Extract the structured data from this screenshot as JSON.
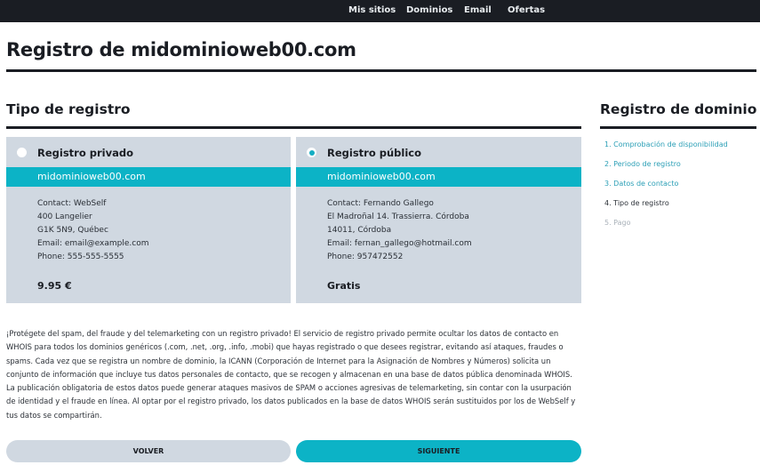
{
  "topnav": [
    "Mis sitios",
    "Dominios",
    "Email",
    "Ofertas"
  ],
  "page_title": "Registro de midominioweb00.com",
  "section_title": "Tipo de registro",
  "sidebar_title": "Registro de dominio",
  "options": [
    {
      "title": "Registro privado",
      "selected": false,
      "domain": "midominioweb00.com",
      "lines": [
        "Contact: WebSelf",
        "400 Langelier",
        "G1K 5N9, Québec",
        "Email: email@example.com",
        "Phone: 555-555-5555"
      ],
      "price": "9.95 €"
    },
    {
      "title": "Registro público",
      "selected": true,
      "domain": "midominioweb00.com",
      "lines": [
        "Contact: Fernando Gallego",
        "El Madroñal 14. Trassierra. Córdoba",
        "14011, Córdoba",
        "Email: fernan_gallego@hotmail.com",
        "Phone: 957472552"
      ],
      "price": "Gratis"
    }
  ],
  "steps": [
    {
      "label": "1. Comprobación de disponibilidad",
      "state": "done"
    },
    {
      "label": "2. Periodo de registro",
      "state": "done"
    },
    {
      "label": "3. Datos de contacto",
      "state": "done"
    },
    {
      "label": "4. Tipo de registro",
      "state": "current"
    },
    {
      "label": "5. Pago",
      "state": "future"
    }
  ],
  "info_text": "¡Protégete del spam, del fraude y del telemarketing con un registro privado! El servicio de registro privado permite ocultar los datos de contacto en WHOIS para todos los dominios genéricos (.com, .net, .org, .info, .mobi) que hayas registrado o que desees registrar, evitando así ataques, fraudes o spams. Cada vez que se registra un nombre de dominio, la ICANN (Corporación de Internet para la Asignación de Nombres y Números) solicita un conjunto de información que incluye tus datos personales de contacto, que se recogen y almacenan en una base de datos pública denominada WHOIS. La publicación obligatoria de estos datos puede generar ataques masivos de SPAM o acciones agresivas de telemarketing, sin contar con la usurpación de identidad y el fraude en línea. Al optar por el registro privado, los datos publicados en la base de datos WHOIS serán sustituidos por los de WebSelf y tus datos se compartirán.",
  "buttons": {
    "back": "VOLVER",
    "next": "SIGUIENTE"
  },
  "colors": {
    "accent": "#0cb3c6",
    "card": "#d0d8e1",
    "nav_bg": "#1a1d23",
    "step_link": "#2b9fb6",
    "step_future": "#a9b1b9"
  }
}
